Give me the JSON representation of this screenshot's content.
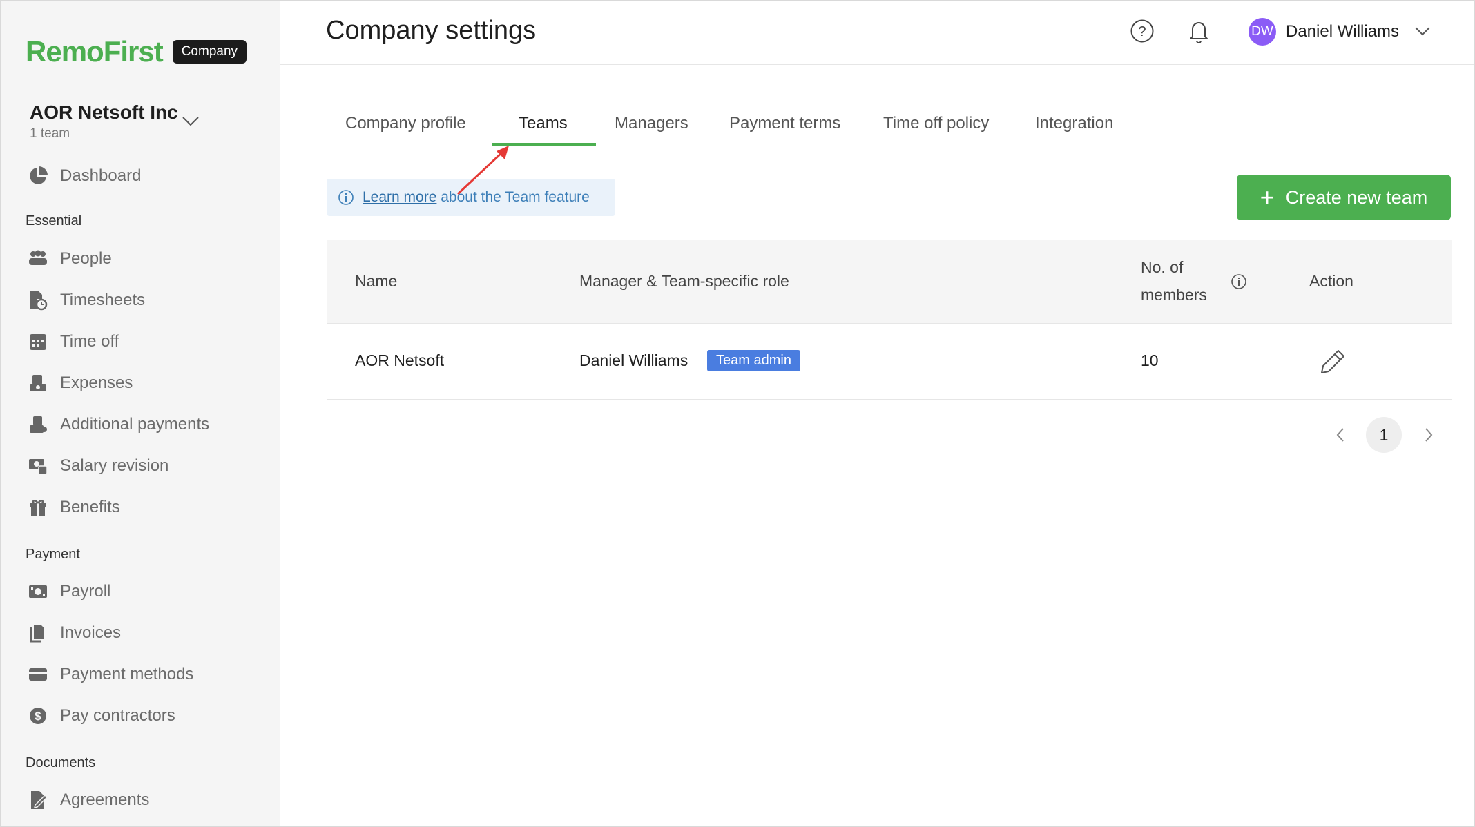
{
  "app": {
    "logo": "RemoFirst",
    "badge": "Company"
  },
  "org": {
    "name": "AOR Netsoft Inc",
    "sub": "1 team"
  },
  "sidebar": {
    "dashboard": "Dashboard",
    "sections": {
      "essential": "Essential",
      "payment": "Payment",
      "documents": "Documents"
    },
    "essential": [
      {
        "label": "People",
        "icon": "people-icon"
      },
      {
        "label": "Timesheets",
        "icon": "timesheets-icon"
      },
      {
        "label": "Time off",
        "icon": "calendar-icon"
      },
      {
        "label": "Expenses",
        "icon": "expenses-icon"
      },
      {
        "label": "Additional payments",
        "icon": "additional-payments-icon"
      },
      {
        "label": "Salary revision",
        "icon": "salary-revision-icon"
      },
      {
        "label": "Benefits",
        "icon": "gift-icon"
      }
    ],
    "payment": [
      {
        "label": "Payroll",
        "icon": "payroll-icon"
      },
      {
        "label": "Invoices",
        "icon": "invoices-icon"
      },
      {
        "label": "Payment methods",
        "icon": "card-icon"
      },
      {
        "label": "Pay contractors",
        "icon": "dollar-icon"
      }
    ],
    "documents": [
      {
        "label": "Agreements",
        "icon": "agreement-icon"
      }
    ]
  },
  "header": {
    "title": "Company settings",
    "user_initials": "DW",
    "user_name": "Daniel Williams"
  },
  "tabs": [
    "Company profile",
    "Teams",
    "Managers",
    "Payment terms",
    "Time off policy",
    "Integration"
  ],
  "active_tab": "Teams",
  "info": {
    "link": "Learn more",
    "text": " about the Team feature"
  },
  "create_button": "Create new team",
  "table": {
    "headers": {
      "name": "Name",
      "manager": "Manager & Team-specific role",
      "members_1": "No. of",
      "members_2": "members",
      "action": "Action"
    },
    "rows": [
      {
        "name": "AOR Netsoft",
        "manager": "Daniel Williams",
        "role": "Team admin",
        "members": "10"
      }
    ]
  },
  "pagination": {
    "current": "1"
  },
  "colors": {
    "brand": "#4caf50",
    "badge": "#4a7de0",
    "avatar": "#8b5cf6",
    "info_bg": "#eaf2fa"
  }
}
